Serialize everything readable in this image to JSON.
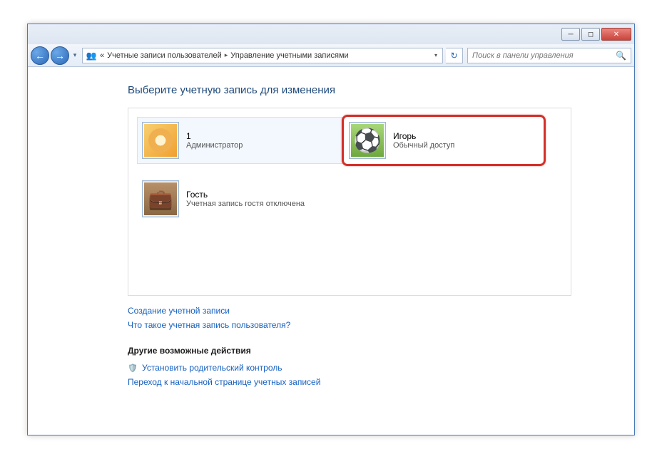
{
  "breadcrumb": {
    "prefix": "«",
    "item1": "Учетные записи пользователей",
    "item2": "Управление учетными записями"
  },
  "search": {
    "placeholder": "Поиск в панели управления"
  },
  "heading": "Выберите учетную запись для изменения",
  "accounts": [
    {
      "name": "1",
      "role": "Администратор"
    },
    {
      "name": "Игорь",
      "role": "Обычный доступ"
    },
    {
      "name": "Гость",
      "role": "Учетная запись гостя отключена"
    }
  ],
  "links": {
    "create": "Создание учетной записи",
    "whatis": "Что такое учетная запись пользователя?"
  },
  "other_section": "Другие возможные действия",
  "actions": {
    "parental": "Установить родительский контроль",
    "gohome": "Переход к начальной странице учетных записей"
  }
}
